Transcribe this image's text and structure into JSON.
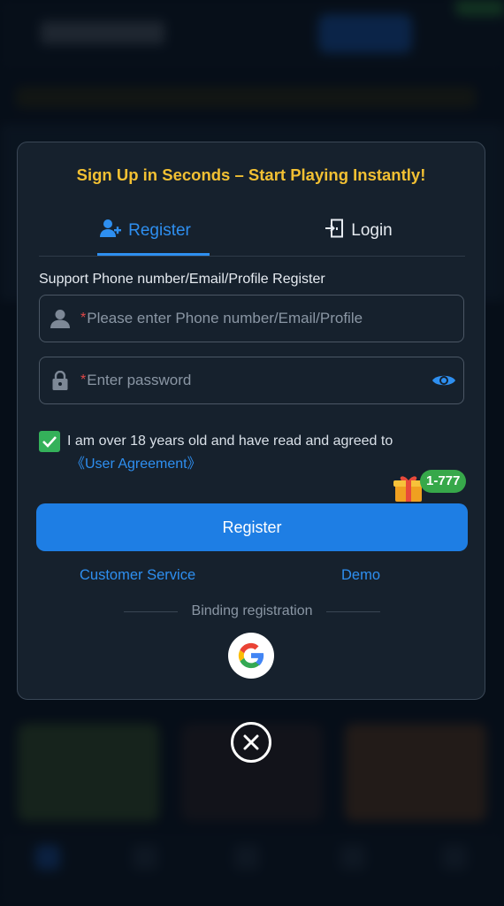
{
  "modal": {
    "title": "Sign Up in Seconds – Start Playing Instantly!",
    "tabs": [
      {
        "label": "Register",
        "icon": "add-user-icon",
        "active": true
      },
      {
        "label": "Login",
        "icon": "door-login-icon",
        "active": false
      }
    ],
    "support_label": "Support Phone number/Email/Profile Register",
    "account_field": {
      "required_mark": "*",
      "placeholder": "Please enter Phone number/Email/Profile",
      "value": "",
      "icon": "user-icon"
    },
    "password_field": {
      "required_mark": "*",
      "placeholder": "Enter password",
      "value": "",
      "icon": "lock-icon",
      "toggle_icon": "eye-icon"
    },
    "agreement": {
      "checked": true,
      "text": "I am over 18 years old and have read and agreed to",
      "link": "《User Agreement》"
    },
    "gift_badge": "1-777",
    "register_button": "Register",
    "customer_service": "Customer Service",
    "demo": "Demo",
    "binding_label": "Binding registration",
    "google_icon": "google-icon"
  },
  "close_icon": "close-icon",
  "colors": {
    "accent": "#1e7ee4",
    "title": "#f2c033",
    "check": "#34b15a",
    "badge": "#37a84a",
    "modal_bg": "#16212d"
  }
}
